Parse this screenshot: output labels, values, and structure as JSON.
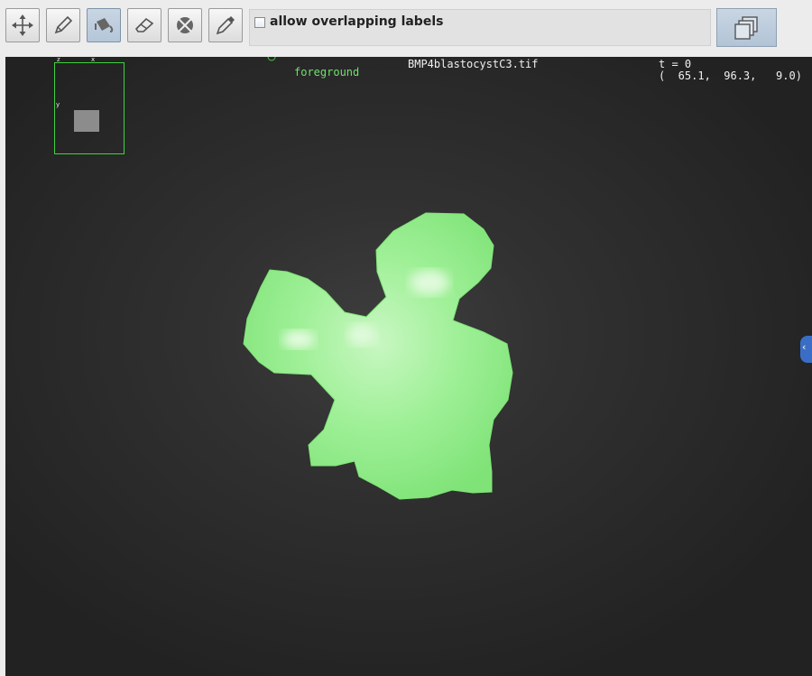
{
  "toolbar": {
    "tools": [
      {
        "name": "move",
        "icon": "move-icon",
        "active": false
      },
      {
        "name": "paint",
        "icon": "pencil-icon",
        "active": false
      },
      {
        "name": "fill",
        "icon": "bucket-fill-icon",
        "active": true
      },
      {
        "name": "erase",
        "icon": "eraser-icon",
        "active": false
      },
      {
        "name": "erase-label",
        "icon": "erase-label-icon",
        "active": false
      },
      {
        "name": "pick-label",
        "icon": "eyedropper-icon",
        "active": false
      }
    ],
    "overlap_label": "allow overlapping labels",
    "overlap_checked": false,
    "layers_icon": "layers-icon"
  },
  "viewer": {
    "label_name": "foreground",
    "file_name": "BMP4blastocystC3.tif",
    "time": "t = 0",
    "coordinates": "(  65.1,  96.3,   9.0)",
    "navigator_axes": {
      "z": "z",
      "x": "x",
      "y": "y"
    },
    "label_color": "#8ef08a",
    "label_outline": "#3fd23f",
    "background_color": "#262626"
  }
}
